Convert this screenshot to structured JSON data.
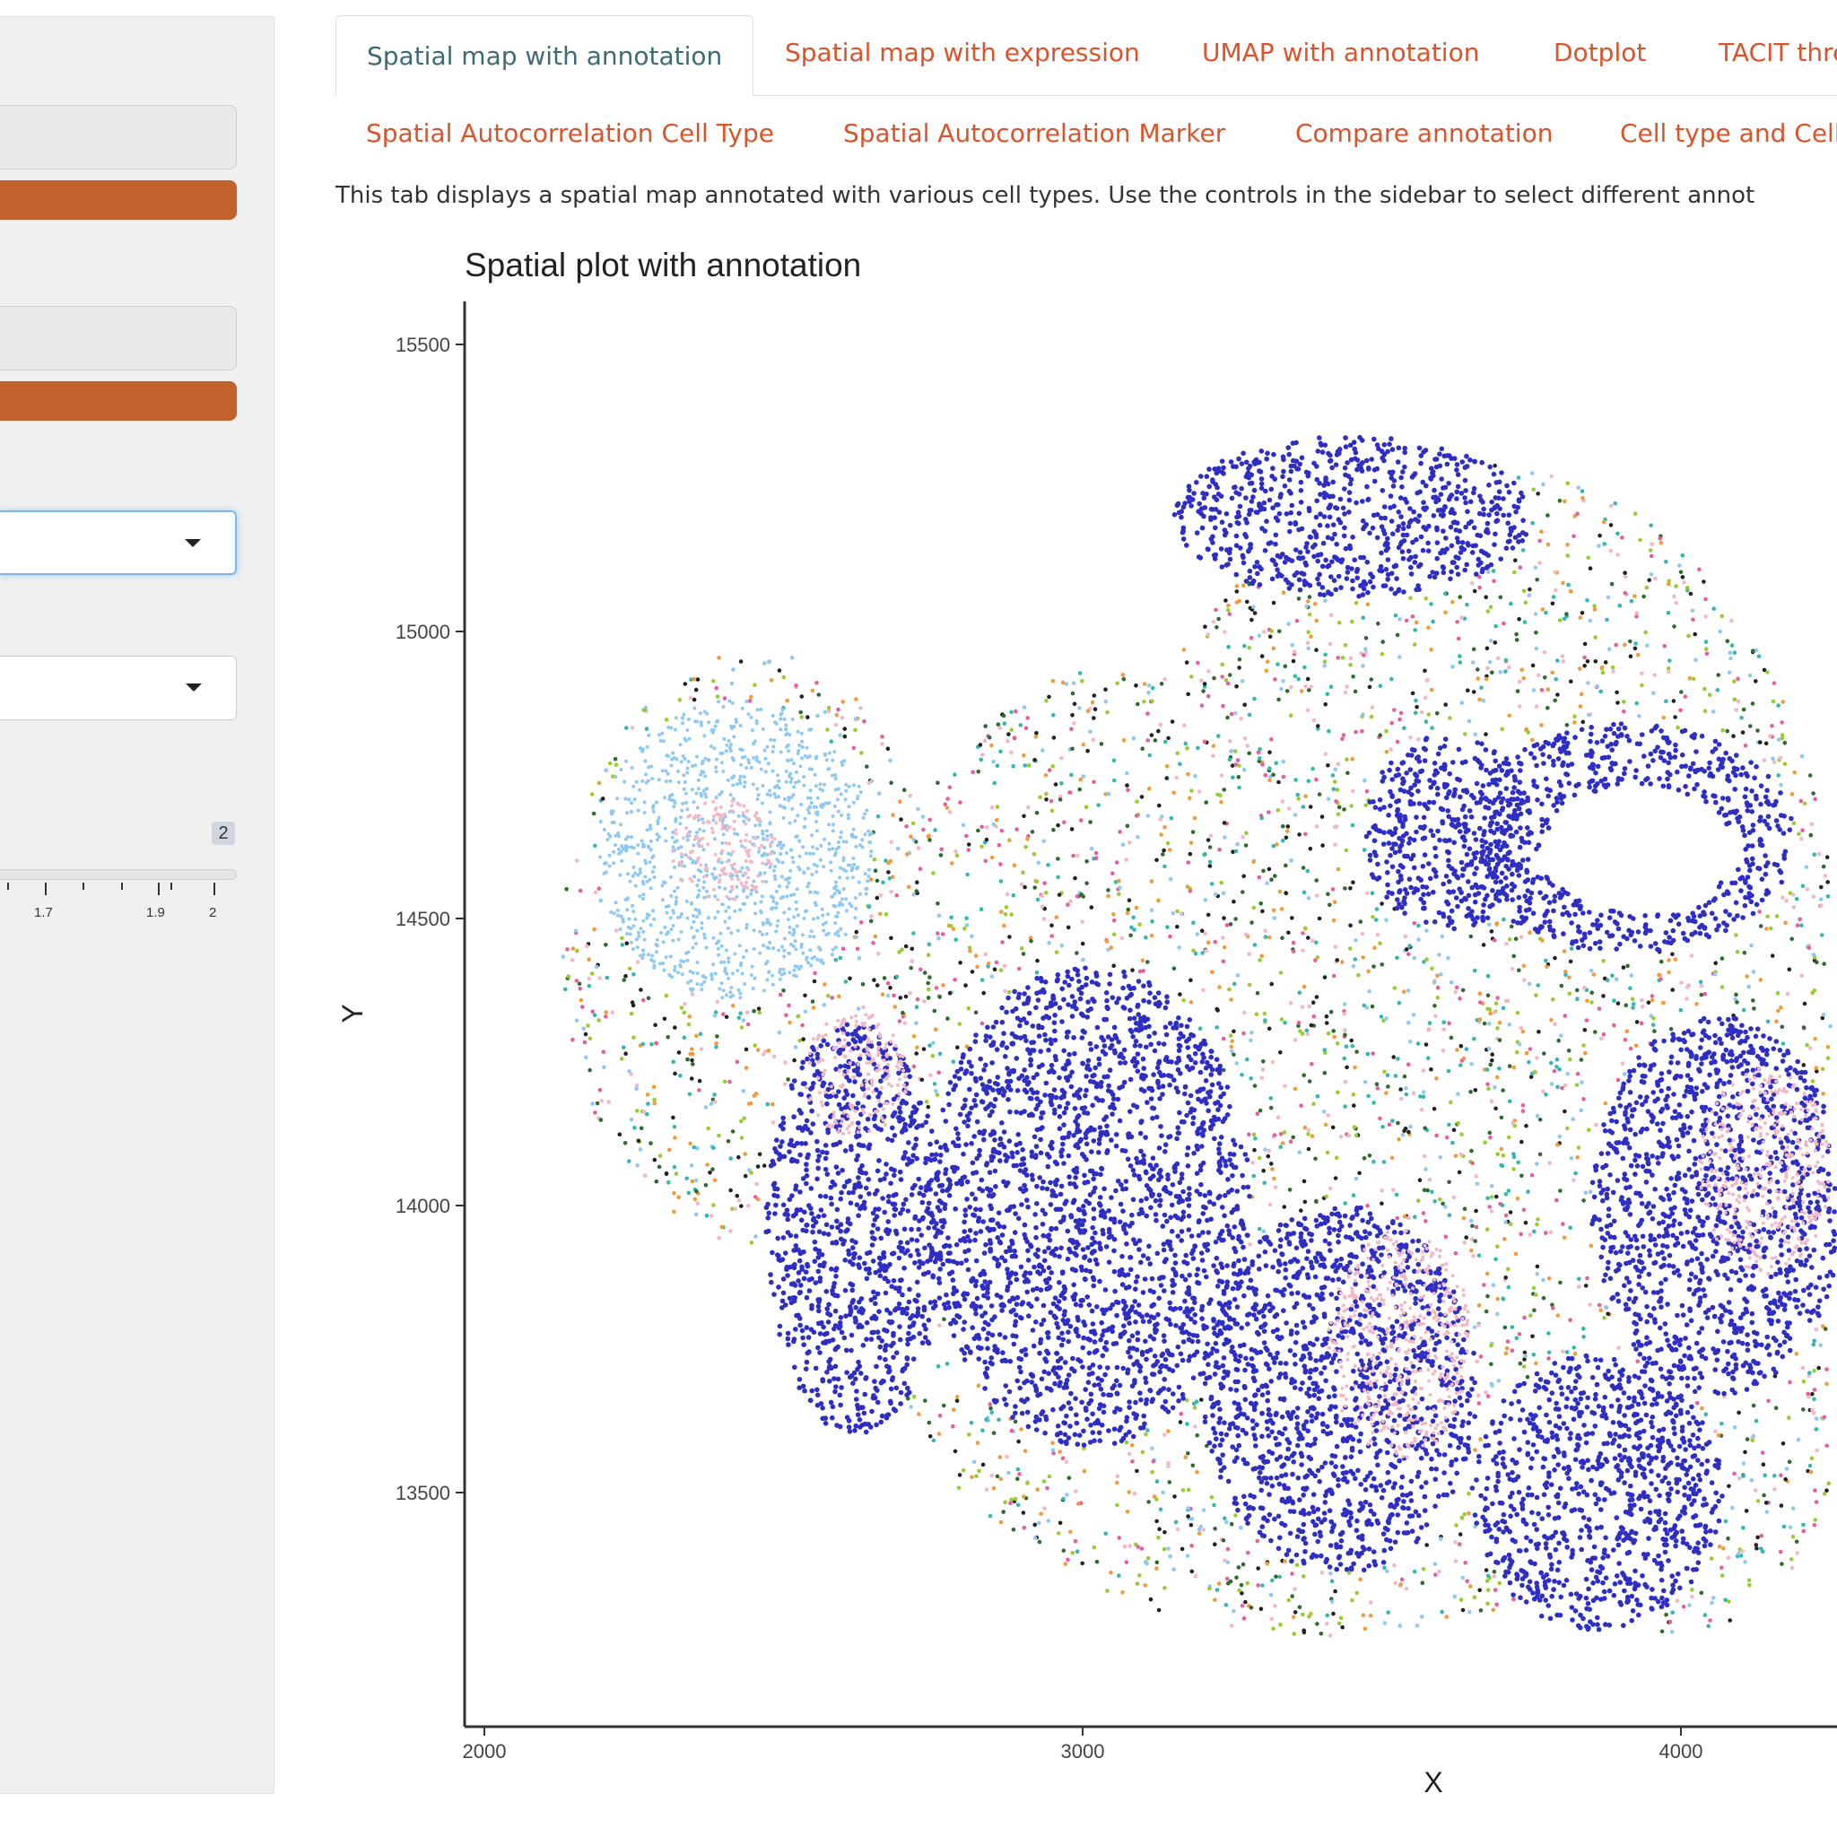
{
  "sidebar": {
    "slider": {
      "value_label": "2",
      "tick_labels": [
        "1.7",
        "1.9",
        "2"
      ]
    }
  },
  "tabs": [
    {
      "label": "Spatial map with annotation",
      "active": true
    },
    {
      "label": "Spatial map with expression"
    },
    {
      "label": "UMAP with annotation"
    },
    {
      "label": "Dotplot"
    },
    {
      "label": "TACIT thre"
    },
    {
      "label": "Spatial Autocorrelation Cell Type"
    },
    {
      "label": "Spatial Autocorrelation Marker"
    },
    {
      "label": "Compare annotation"
    },
    {
      "label": "Cell type and Cell"
    }
  ],
  "description": "This tab displays a spatial map annotated with various cell types. Use the controls in the sidebar to select different annot",
  "chart_data": {
    "type": "scatter",
    "title": "Spatial plot with annotation",
    "xlabel": "X",
    "ylabel": "Y",
    "x_ticks": [
      "2000",
      "3000",
      "4000"
    ],
    "y_ticks": [
      "13500",
      "14000",
      "14500",
      "15000",
      "15500"
    ],
    "xlim": [
      1970,
      4250
    ],
    "ylim": [
      13110,
      15570
    ],
    "grid": false,
    "legend": "none",
    "point_colors": [
      "#2e2ec4",
      "#8fc9f2",
      "#f2b8c6",
      "#f29b3a",
      "#34b7b0",
      "#e85d9e",
      "#2f6b2f",
      "#99cc33",
      "#222222"
    ],
    "regions": [
      {
        "name": "blue-follicle",
        "cx": 3010,
        "cy": 14000,
        "rx": 270,
        "ry": 420,
        "color": "#2e2ec4"
      },
      {
        "name": "blue-follicle",
        "cx": 3430,
        "cy": 13680,
        "rx": 230,
        "ry": 320,
        "color": "#2e2ec4"
      },
      {
        "name": "blue-follicle",
        "cx": 3610,
        "cy": 14650,
        "rx": 140,
        "ry": 170,
        "color": "#2e2ec4"
      },
      {
        "name": "blue-follicle",
        "cx": 3450,
        "cy": 15200,
        "rx": 300,
        "ry": 140,
        "color": "#2e2ec4"
      },
      {
        "name": "blue-follicle",
        "cx": 3910,
        "cy": 14640,
        "rx": 280,
        "ry": 200,
        "color": "#2e2ec4"
      },
      {
        "name": "blue-follicle",
        "cx": 4060,
        "cy": 14000,
        "rx": 210,
        "ry": 330,
        "color": "#2e2ec4"
      },
      {
        "name": "blue-follicle",
        "cx": 2620,
        "cy": 13960,
        "rx": 150,
        "ry": 360,
        "color": "#2e2ec4"
      },
      {
        "name": "blue-follicle",
        "cx": 3860,
        "cy": 13500,
        "rx": 210,
        "ry": 240,
        "color": "#2e2ec4"
      },
      {
        "name": "light-blue-zone",
        "cx": 2420,
        "cy": 14620,
        "rx": 230,
        "ry": 260,
        "color": "#8fc9f2"
      },
      {
        "name": "pink-zone",
        "cx": 2400,
        "cy": 14620,
        "rx": 90,
        "ry": 90,
        "color": "#f2b8c6"
      },
      {
        "name": "pink-zone",
        "cx": 3530,
        "cy": 13760,
        "rx": 120,
        "ry": 200,
        "color": "#f2b8c6"
      },
      {
        "name": "pink-zone",
        "cx": 2620,
        "cy": 14230,
        "rx": 90,
        "ry": 110,
        "color": "#f2b8c6"
      },
      {
        "name": "pink-zone",
        "cx": 4140,
        "cy": 14060,
        "rx": 110,
        "ry": 180,
        "color": "#f2b8c6"
      }
    ],
    "mixed_band": {
      "colors": [
        "#f29b3a",
        "#34b7b0",
        "#e85d9e",
        "#2f6b2f",
        "#99cc33",
        "#222222",
        "#8fc9f2",
        "#f2b8c6"
      ]
    }
  }
}
